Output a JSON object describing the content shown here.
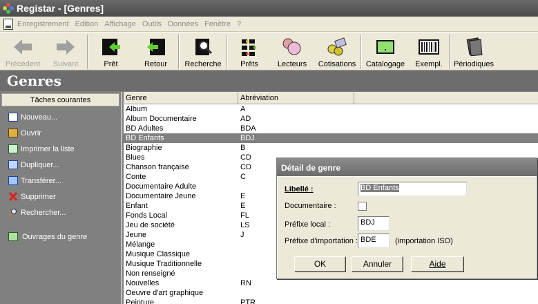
{
  "window": {
    "title": "Registar - [Genres]"
  },
  "menu": [
    "Enregistrement",
    "Edition",
    "Affichage",
    "Outils",
    "Données",
    "Fenêtre",
    "?"
  ],
  "toolbar": {
    "precedent": "Précédent",
    "suivant": "Suivant",
    "pret": "Prêt",
    "retour": "Retour",
    "recherche": "Recherche",
    "prets": "Prêts",
    "lecteurs": "Lecteurs",
    "cotisations": "Cotisations",
    "catalogage": "Catalogage",
    "exempl": "Exempl.",
    "periodiques": "Périodiques"
  },
  "page": {
    "heading": "Genres"
  },
  "sidebar": {
    "header": "Tâches courantes",
    "tasks": [
      "Nouveau...",
      "Ouvrir",
      "Imprimer la liste",
      "Dupliquer...",
      "Transférer...",
      "Supprimer",
      "Rechercher..."
    ],
    "extra": "Ouvrages du genre"
  },
  "grid": {
    "columns": [
      "Genre",
      "Abréviation"
    ],
    "rows": [
      [
        "Album",
        "A"
      ],
      [
        "Album Documentaire",
        "AD"
      ],
      [
        "BD Adultes",
        "BDA"
      ],
      [
        "BD Enfants",
        "BDJ"
      ],
      [
        "Biographie",
        "B"
      ],
      [
        "Blues",
        "CD"
      ],
      [
        "Chanson française",
        "CD"
      ],
      [
        "Conte",
        "C"
      ],
      [
        "Documentaire Adulte",
        ""
      ],
      [
        "Documentaire Jeune",
        "E"
      ],
      [
        "Enfant",
        "E"
      ],
      [
        "Fonds Local",
        "FL"
      ],
      [
        "Jeu de société",
        "LS"
      ],
      [
        "Jeune",
        "J"
      ],
      [
        "Mélange",
        ""
      ],
      [
        "Musique Classique",
        ""
      ],
      [
        "Musique Traditionnelle",
        ""
      ],
      [
        "Non renseigné",
        ""
      ],
      [
        "Nouvelles",
        "RN"
      ],
      [
        "Oeuvre d'art graphique",
        ""
      ],
      [
        "Peinture",
        "PTR"
      ]
    ],
    "selected_index": 3
  },
  "dialog": {
    "title": "Détail de genre",
    "libelle_label": "Libellé :",
    "libelle_value": "BD Enfants",
    "documentaire_label": "Documentaire :",
    "documentaire_checked": false,
    "prefixe_local_label": "Préfixe local :",
    "prefixe_local_value": "BDJ",
    "prefixe_import_label": "Préfixe d'importation :",
    "prefixe_import_value": "BDE",
    "import_note": "(importation ISO)",
    "ok": "OK",
    "annuler": "Annuler",
    "aide": "Aide"
  },
  "colors": {
    "selection": "#808080",
    "chrome": "#ece9d8",
    "workspace": "#808080"
  }
}
